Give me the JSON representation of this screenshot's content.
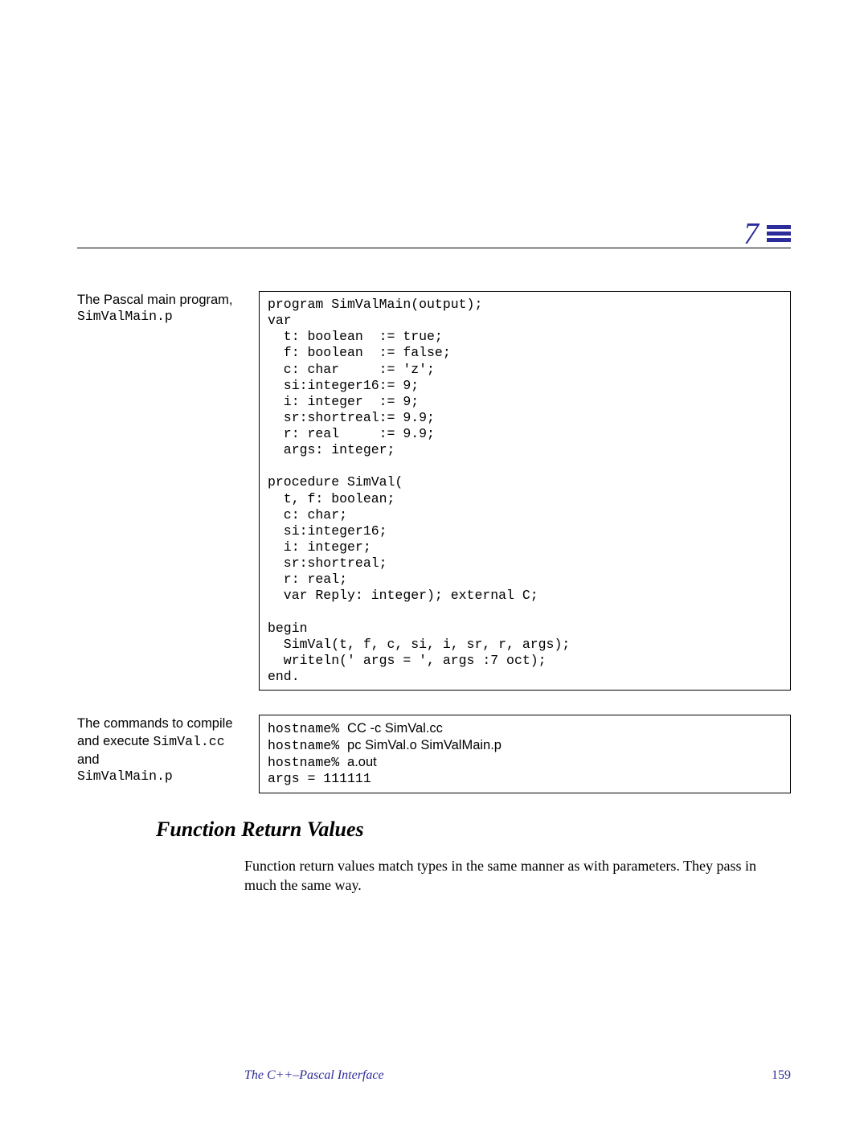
{
  "chapter_number": "7",
  "block1": {
    "label_text": "The Pascal main program,",
    "label_file": "SimValMain.p",
    "code": "program SimValMain(output);\nvar\n  t: boolean  := true;\n  f: boolean  := false;\n  c: char     := 'z';\n  si:integer16:= 9;\n  i: integer  := 9;\n  sr:shortreal:= 9.9;\n  r: real     := 9.9;\n  args: integer;\n\nprocedure SimVal(\n  t, f: boolean;\n  c: char;\n  si:integer16;\n  i: integer;\n  sr:shortreal;\n  r: real;\n  var Reply: integer); external C;\n\nbegin\n  SimVal(t, f, c, si, i, sr, r, args);\n  writeln(' args = ', args :7 oct);\nend."
  },
  "block2": {
    "label_pre": "The commands to compile and execute ",
    "label_f1": "SimVal.cc",
    "label_mid": " and",
    "label_f2": "SimValMain.p",
    "prompt": "hostname% ",
    "cmd1": "CC -c SimVal.cc",
    "cmd2": "pc SimVal.o SimValMain.p",
    "cmd3": "a.out",
    "out": "args = 111111"
  },
  "section_heading": "Function Return Values",
  "body_text": "Function return values match types in the same manner as with parameters. They pass in much the same way.",
  "footer_title": "The C++–Pascal Interface",
  "footer_page": "159"
}
